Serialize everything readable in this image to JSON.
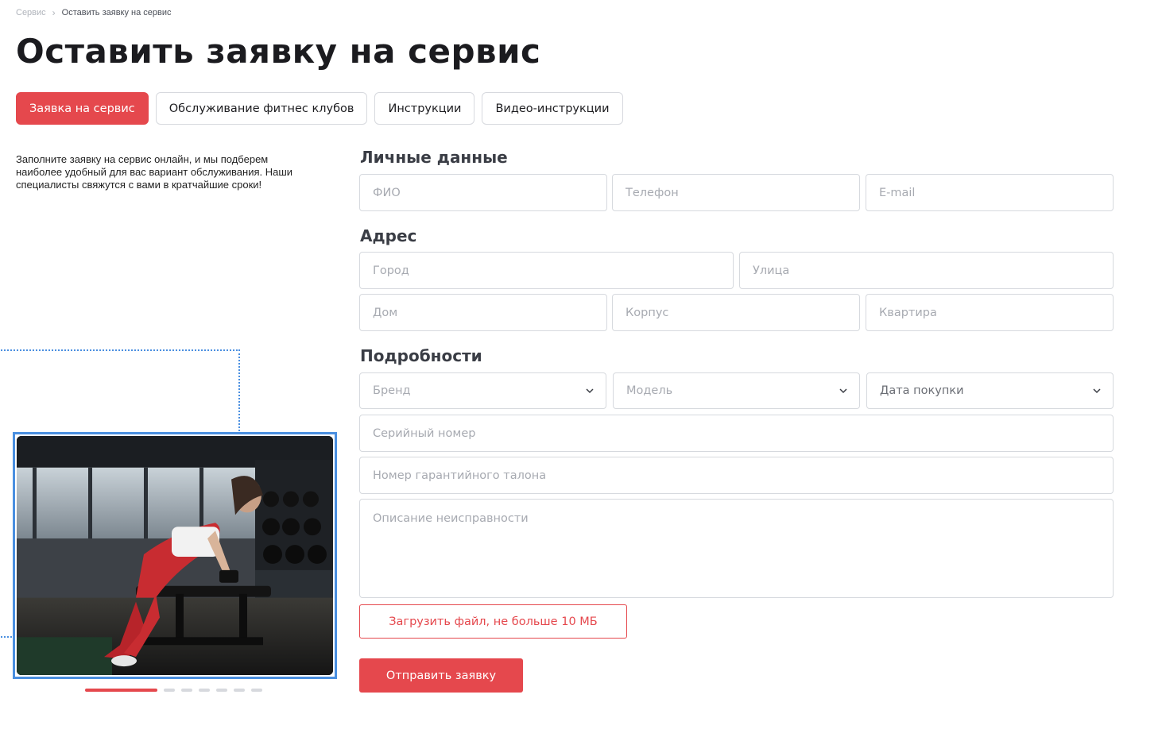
{
  "breadcrumb": {
    "items": [
      {
        "label": "Сервис"
      },
      {
        "label": "Оставить заявку на сервис"
      }
    ]
  },
  "page": {
    "title": "Оставить заявку на сервис"
  },
  "tabs": [
    {
      "label": "Заявка на сервис",
      "active": true
    },
    {
      "label": "Обслуживание фитнес клубов",
      "active": false
    },
    {
      "label": "Инструкции",
      "active": false
    },
    {
      "label": "Видео-инструкции",
      "active": false
    }
  ],
  "intro": {
    "text": "Заполните заявку на сервис онлайн, и мы подберем наиболее удобный для вас вариант обслуживания. Наши специалисты свяжутся с вами в кратчайшие сроки!"
  },
  "slider": {
    "total": 7,
    "current": 1
  },
  "form": {
    "personal": {
      "title": "Личные данные",
      "name_placeholder": "ФИО",
      "phone_placeholder": "Телефон",
      "email_placeholder": "E-mail"
    },
    "address": {
      "title": "Адрес",
      "city_placeholder": "Город",
      "street_placeholder": "Улица",
      "house_placeholder": "Дом",
      "building_placeholder": "Корпус",
      "apartment_placeholder": "Квартира"
    },
    "details": {
      "title": "Подробности",
      "brand_placeholder": "Бренд",
      "model_placeholder": "Модель",
      "purchase_date_placeholder": "Дата покупки",
      "serial_placeholder": "Серийный номер",
      "warranty_placeholder": "Номер гарантийного талона",
      "description_placeholder": "Описание неисправности"
    },
    "upload_label": "Загрузить файл, не больше 10 МБ",
    "submit_label": "Отправить заявку"
  },
  "colors": {
    "accent": "#e5484d",
    "selection": "#4a8fe0",
    "text_dark": "#1b1b1f",
    "placeholder": "#a7aab1",
    "border": "#d6d9de"
  }
}
